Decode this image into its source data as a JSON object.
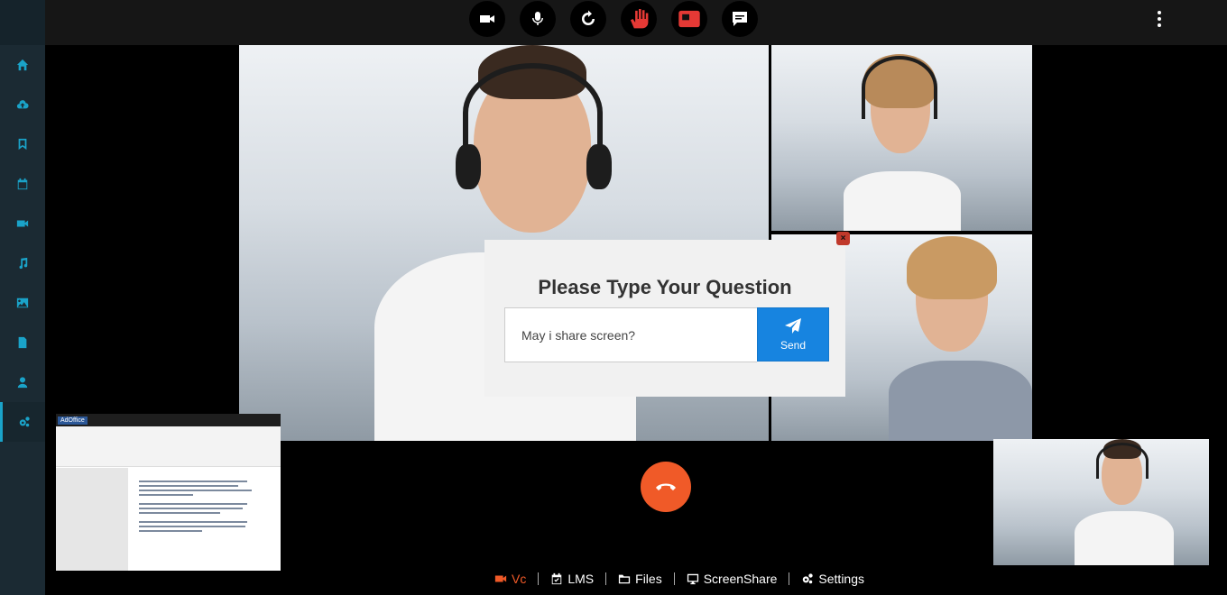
{
  "sidebar": {
    "items": [
      {
        "icon": "home-icon"
      },
      {
        "icon": "cloud-upload-icon"
      },
      {
        "icon": "bookmark-icon"
      },
      {
        "icon": "calendar-icon"
      },
      {
        "icon": "video-icon"
      },
      {
        "icon": "music-icon"
      },
      {
        "icon": "image-icon"
      },
      {
        "icon": "file-icon"
      },
      {
        "icon": "user-icon"
      },
      {
        "icon": "cogs-icon",
        "active": true
      }
    ]
  },
  "toolbar": {
    "buttons": [
      {
        "icon": "camera-icon"
      },
      {
        "icon": "microphone-icon"
      },
      {
        "icon": "refresh-icon"
      },
      {
        "icon": "raise-hand-icon",
        "color": "#e53935"
      },
      {
        "icon": "screen-icon",
        "color": "#e53935"
      },
      {
        "icon": "chat-icon"
      }
    ],
    "more_icon": "more-vertical-icon"
  },
  "question_modal": {
    "title": "Please Type Your Question",
    "input_value": "May i share screen?",
    "send_label": "Send",
    "close_icon": "close-icon",
    "close_glyph": "×"
  },
  "bottom_nav": {
    "items": [
      {
        "label": "Vc",
        "icon": "video-icon",
        "active": true
      },
      {
        "label": "LMS",
        "icon": "calendar-check-icon"
      },
      {
        "label": "Files",
        "icon": "folder-icon"
      },
      {
        "label": "ScreenShare",
        "icon": "desktop-icon"
      },
      {
        "label": "Settings",
        "icon": "cogs-icon"
      }
    ]
  },
  "screen_share": {
    "app_badge": "AdOffice"
  },
  "colors": {
    "accent": "#1aa3c9",
    "end_call": "#f05a28",
    "send": "#1784e0",
    "active_nav": "#f05a28"
  }
}
